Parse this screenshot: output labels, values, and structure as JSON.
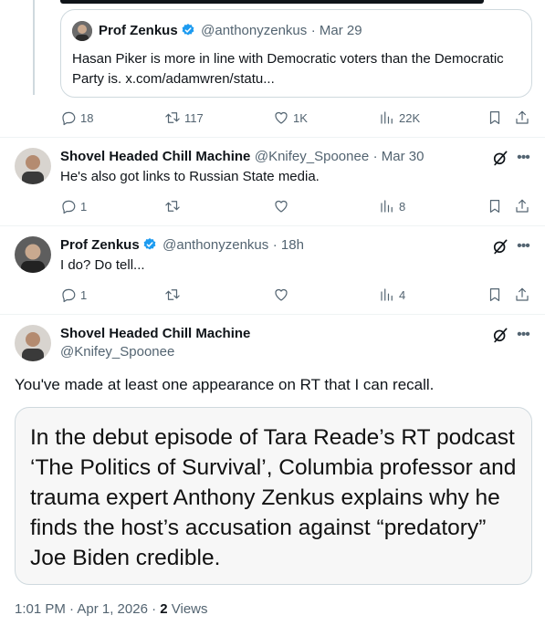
{
  "quoted_tweet": {
    "author_name": "Prof Zenkus",
    "handle": "@anthonyzenkus",
    "date": "· Mar 29",
    "text": "Hasan Piker is more in line with Democratic voters than the Democratic Party is. x.com/adamwren/statu..."
  },
  "tweet1_actions": {
    "replies": "18",
    "reposts": "117",
    "likes": "1K",
    "views": "22K"
  },
  "reply1": {
    "author_name": "Shovel Headed Chill Machine",
    "handle": "@Knifey_Spoonee",
    "date": "· Mar 30",
    "text": "He's also got links to Russian State media.",
    "actions": {
      "replies": "1",
      "reposts": "",
      "likes": "",
      "views": "8"
    }
  },
  "reply2": {
    "author_name": "Prof Zenkus",
    "handle": "@anthonyzenkus",
    "date": "· 18h",
    "text": "I do? Do tell...",
    "actions": {
      "replies": "1",
      "reposts": "",
      "likes": "",
      "views": "4"
    }
  },
  "main_tweet": {
    "author_name": "Shovel Headed Chill Machine",
    "handle": "@Knifey_Spoonee",
    "text": "You've made at least one appearance on RT that I can recall.",
    "image_text": "In the debut episode of Tara Reade’s RT podcast ‘The Politics of Survival’, Columbia professor and trauma expert Anthony Zenkus explains why he finds the host’s accusation against “predatory” Joe Biden credible.",
    "timestamp": "1:01 PM · Apr 1, 2026 · ",
    "views_count": "2",
    "views_label": " Views"
  },
  "icons": {
    "reply": "reply-icon",
    "repost": "repost-icon",
    "like": "heart-icon",
    "views": "views-icon",
    "bookmark": "bookmark-icon",
    "share": "share-icon",
    "grok": "grok-icon",
    "more": "more-icon",
    "verified": "verified-badge-icon"
  },
  "colors": {
    "verified": "#1d9bf0",
    "muted": "#536471",
    "text": "#0f1419",
    "border": "#cfd9de"
  }
}
